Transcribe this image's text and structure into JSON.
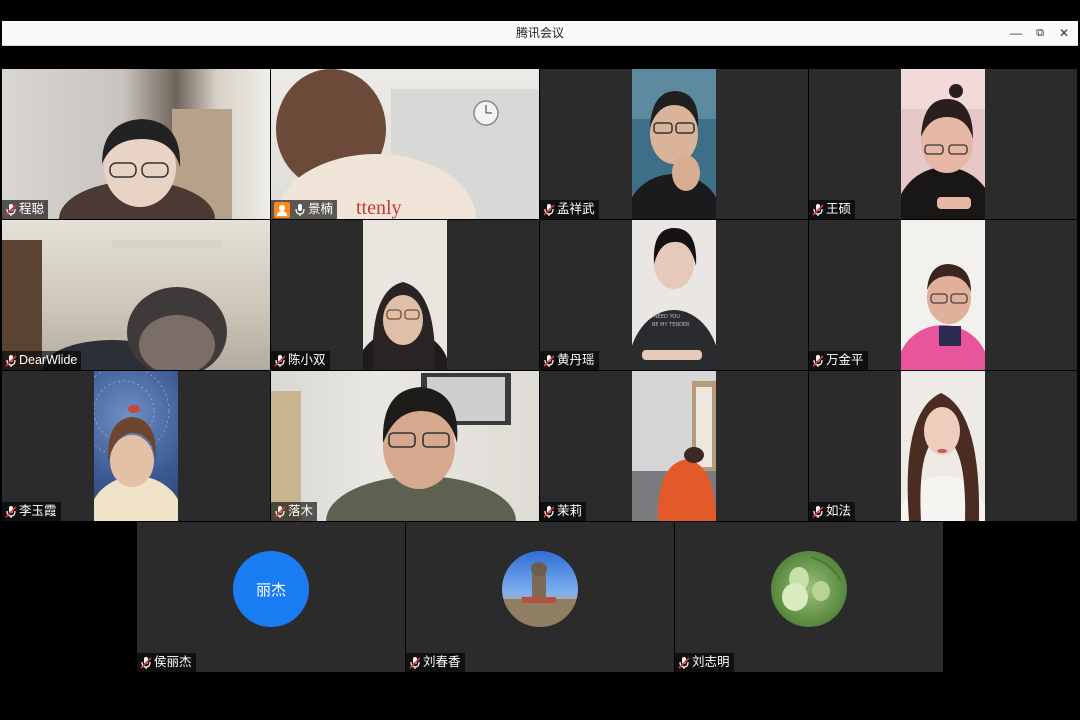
{
  "window": {
    "title": "腾讯会议",
    "controls": {
      "minimize": "—",
      "restore": "⧉",
      "close": "✕"
    }
  },
  "participants": [
    {
      "name": "程聪",
      "mic": "muted"
    },
    {
      "name": "景楠",
      "mic": "on",
      "host": true,
      "speaking": true
    },
    {
      "name": "孟祥武",
      "mic": "muted"
    },
    {
      "name": "王硕",
      "mic": "muted"
    },
    {
      "name": "DearWlide",
      "mic": "muted"
    },
    {
      "name": "陈小双",
      "mic": "muted"
    },
    {
      "name": "黄丹瑶",
      "mic": "muted"
    },
    {
      "name": "万金平",
      "mic": "muted"
    },
    {
      "name": "李玉霞",
      "mic": "muted"
    },
    {
      "name": "落木",
      "mic": "muted"
    },
    {
      "name": "茉莉",
      "mic": "muted"
    },
    {
      "name": "如法",
      "mic": "muted"
    },
    {
      "name": "侯丽杰",
      "mic": "muted",
      "avatar_text": "丽杰",
      "avatar_color": "#1a7cf3"
    },
    {
      "name": "刘春香",
      "mic": "muted",
      "avatar_image": "monument-landscape"
    },
    {
      "name": "刘志明",
      "mic": "muted",
      "avatar_image": "green-gourds"
    }
  ],
  "colors": {
    "active_speaker_border": "#3fb17a",
    "host_badge": "#ff8a1a",
    "mic_muted": "#e0393e"
  }
}
